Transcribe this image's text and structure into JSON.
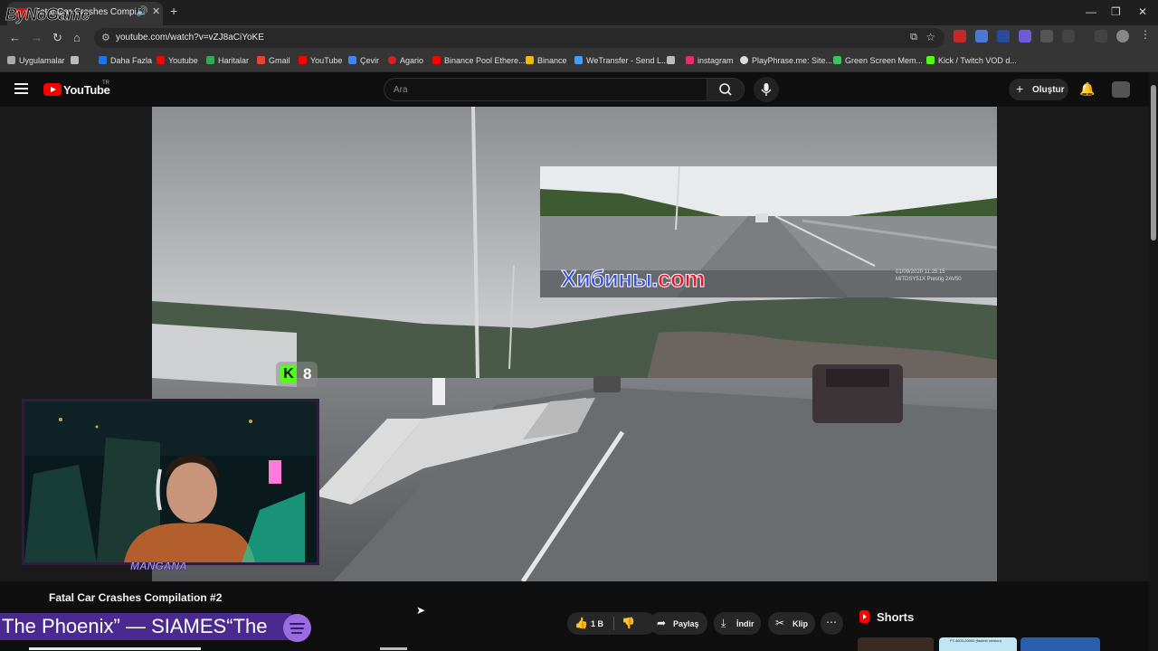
{
  "browser": {
    "watermark": "ByNoGame",
    "tab": {
      "title": "Fatal Car Crashes Compilation #2 - YouTube"
    },
    "url": "youtube.com/watch?v=vZJ8aCiYoKE",
    "bookmarks": [
      {
        "label": "Uygulamalar",
        "color": "#aaaaaa"
      },
      {
        "label": "Daha Fazla",
        "color": "#1877f2"
      },
      {
        "label": "Youtube",
        "color": "#ff0000"
      },
      {
        "label": "Haritalar",
        "color": "#34a853"
      },
      {
        "label": "Gmail",
        "color": "#ea4335"
      },
      {
        "label": "YouTube",
        "color": "#ff0000"
      },
      {
        "label": "Çevir",
        "color": "#4285f4"
      },
      {
        "label": "Agario",
        "color": "#e02020"
      },
      {
        "label": "Binance Pool Ethere...",
        "color": "#ff0000"
      },
      {
        "label": "Binance",
        "color": "#f0b90b"
      },
      {
        "label": "WeTransfer - Send L...",
        "color": "#409fff"
      },
      {
        "label": "instagram",
        "color": "#e1306c"
      },
      {
        "label": "PlayPhrase.me: Site...",
        "color": "#dddddd"
      },
      {
        "label": "Green Screen Mem...",
        "color": "#34c759"
      },
      {
        "label": "Kick / Twitch VOD d...",
        "color": "#53fc18"
      }
    ]
  },
  "youtube": {
    "logo_text": "YouTube",
    "country": "TR",
    "search_placeholder": "Ara",
    "create_label": "Oluştur"
  },
  "video": {
    "overlay_brand": "Хибины.",
    "overlay_brand_tld": "com",
    "dashcam_stamp_1": "01/09/2020  11:25:15",
    "dashcam_stamp_2": "MiTDSY51X Prestig 2AV50",
    "kick_badge_letter": "K",
    "kick_viewers": "8",
    "webcam_tag": "MANGANA"
  },
  "below": {
    "title": "Fatal Car Crashes Compilation #2",
    "now_playing": "The Phoenix” — SIAMES“The",
    "like_count": "1 B",
    "share_label": "Paylaş",
    "download_label": "İndir",
    "clip_label": "Klip",
    "shorts_label": "Shorts",
    "short_1_title": "FT-4603-20000 (fastest version)"
  }
}
